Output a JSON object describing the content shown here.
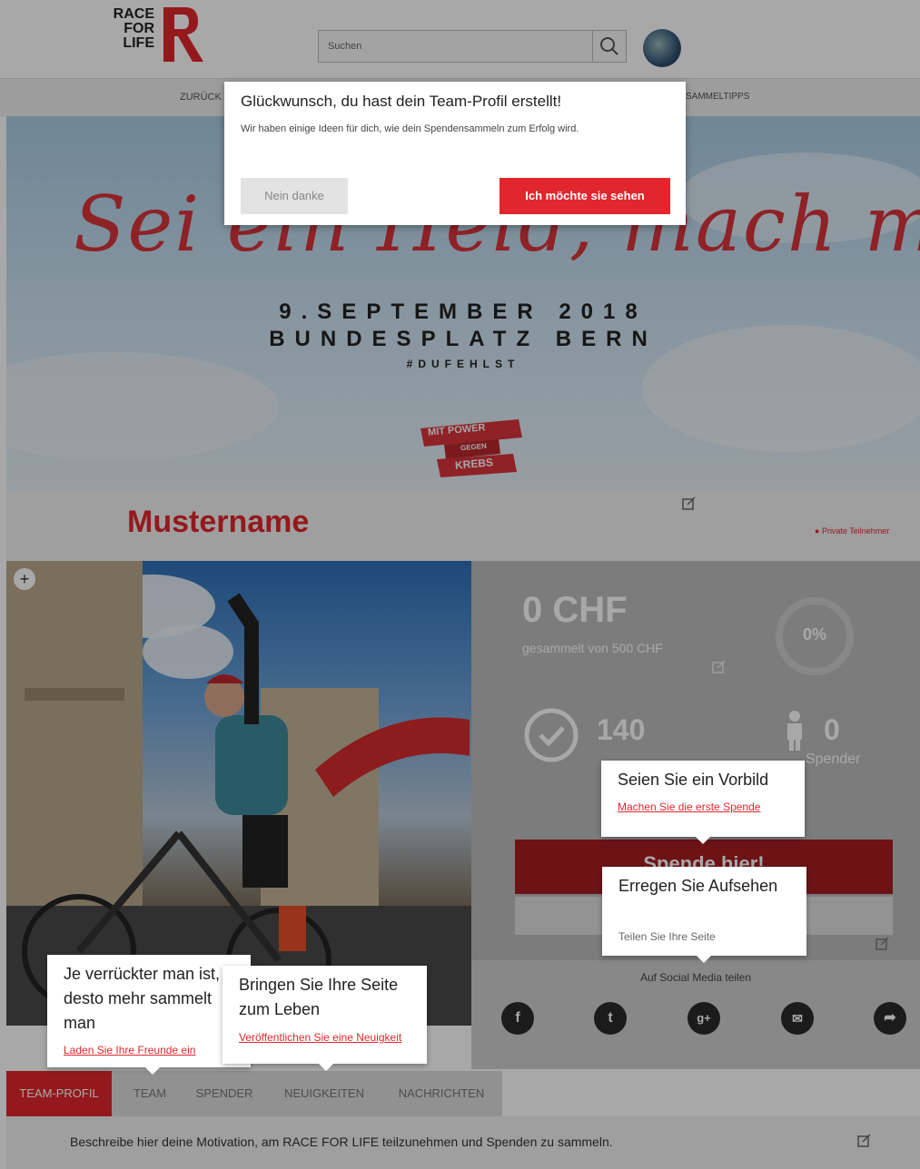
{
  "header": {
    "logo_line1": "RACE",
    "logo_line2": "FOR",
    "logo_line3": "LIFE",
    "search_placeholder": "Suchen",
    "nav_left": "ZURÜCK",
    "nav_right": "SAMMELTIPPS"
  },
  "hero": {
    "script_text": "Sei ein Held, mach mit",
    "date_line": "9.SEPTEMBER 2018",
    "place_line": "BUNDESPLATZ BERN",
    "hashtag": "#DUFEHLST",
    "badge_line1": "MIT POWER",
    "badge_line2": "GEGEN",
    "badge_line3": "KREBS"
  },
  "profile": {
    "name": "Mustername",
    "private_label": "Private Teilnehmer"
  },
  "stats": {
    "amount": "0 CHF",
    "goal_text": "gesammelt von 500 CHF",
    "percent": "0%",
    "days": "140",
    "donors": "0",
    "donors_label": "Spender",
    "donate_button": "Spende hier!"
  },
  "social": {
    "label": "Auf Social Media teilen",
    "icons": [
      "facebook-icon",
      "twitter-icon",
      "google-plus-icon",
      "mail-icon",
      "share-icon"
    ]
  },
  "tabs": [
    "TEAM-PROFIL",
    "TEAM",
    "SPENDER",
    "NEUIGKEITEN",
    "NACHRICHTEN"
  ],
  "motivation": "Beschreibe hier deine Motivation, am RACE FOR LIFE teilzunehmen und Spenden zu sammeln.",
  "modal": {
    "title": "Glückwunsch, du hast dein Team-Profil erstellt!",
    "body": "Wir haben einige Ideen für dich, wie dein Spendensammeln zum Erfolg wird.",
    "decline": "Nein danke",
    "accept": "Ich möchte sie sehen"
  },
  "tips": {
    "vorbild_title": "Seien Sie ein Vorbild",
    "vorbild_link": "Machen Sie die erste Spende",
    "aufsehen_title": "Erregen Sie Aufsehen",
    "aufsehen_sub": "Teilen Sie Ihre Seite",
    "freunde_title": "Je verrückter man ist, desto mehr sammelt man",
    "freunde_link": "Laden Sie Ihre Freunde ein",
    "leben_title": "Bringen Sie Ihre Seite zum Leben",
    "leben_link": "Veröffentlichen Sie eine Neuigkeit"
  },
  "colors": {
    "brand_red": "#e1262d",
    "overlay": "rgba(0,0,0,0.34)"
  }
}
